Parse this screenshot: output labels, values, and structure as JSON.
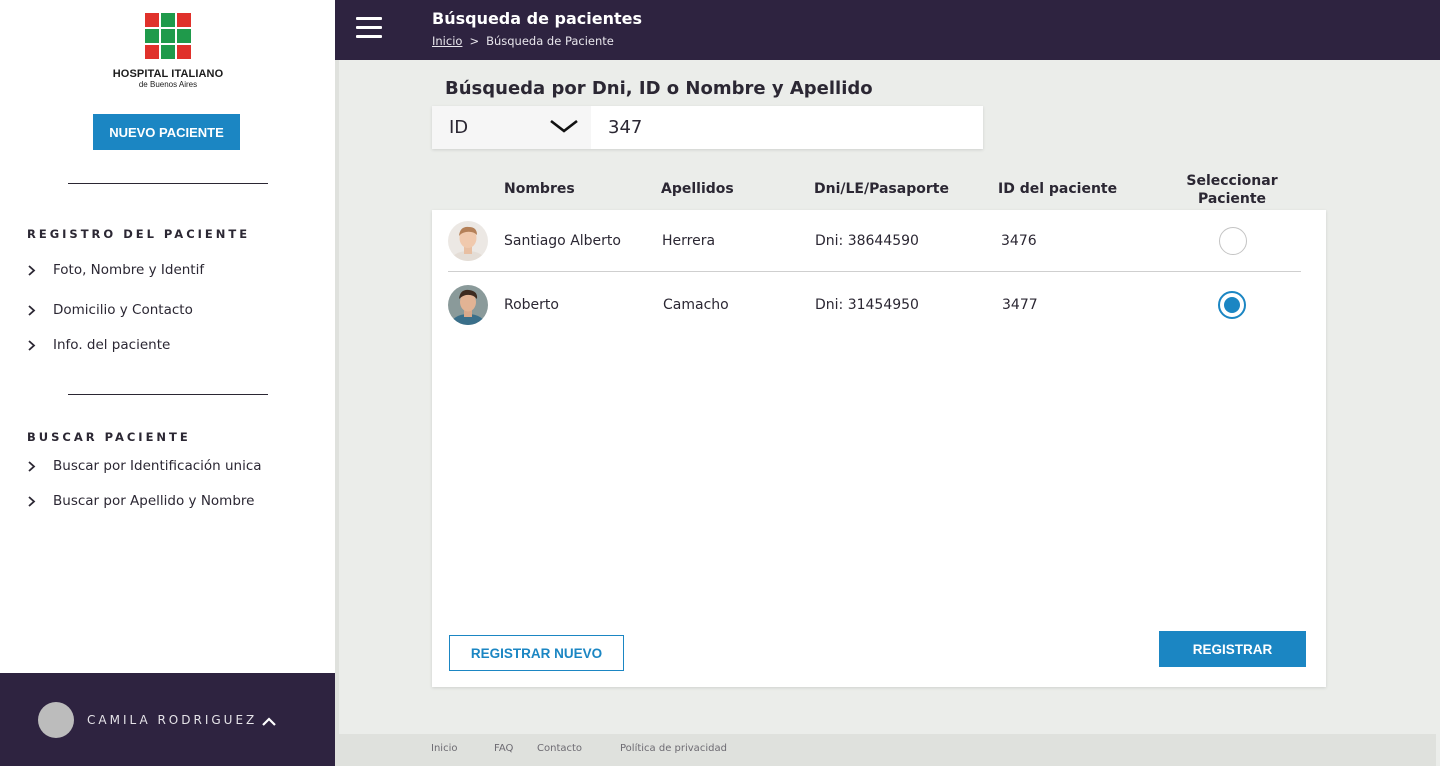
{
  "brand": {
    "name": "HOSPITAL ITALIANO",
    "sub": "de Buenos Aires",
    "colors": {
      "green": "#1f9a4b",
      "red": "#e0312b"
    }
  },
  "sidebar": {
    "new_patient_label": "NUEVO PACIENTE",
    "sections": [
      {
        "title": "REGISTRO DEL PACIENTE",
        "items": [
          "Foto, Nombre y Identif",
          "Domicilio y Contacto",
          "Info. del paciente"
        ]
      },
      {
        "title": "BUSCAR PACIENTE",
        "items": [
          "Buscar por Identificación unica",
          "Buscar por Apellido y Nombre"
        ]
      }
    ],
    "user": {
      "name": "CAMILA RODRIGUEZ",
      "menu_icon": "chevron-up-icon"
    }
  },
  "header": {
    "title": "Búsqueda de pacientes",
    "breadcrumb": {
      "home": "Inicio",
      "separator": ">",
      "current": "Búsqueda de Paciente"
    }
  },
  "search": {
    "heading": "Búsqueda por Dni, ID o Nombre y Apellido",
    "type_selected": "ID",
    "query": "347"
  },
  "table": {
    "columns": [
      "Nombres",
      "Apellidos",
      "Dni/LE/Pasaporte",
      "ID del paciente",
      "Seleccionar Paciente"
    ],
    "rows": [
      {
        "nombres": "Santiago Alberto",
        "apellidos": "Herrera",
        "dni": "Dni: 38644590",
        "id": "3476",
        "selected": false
      },
      {
        "nombres": "Roberto",
        "apellidos": "Camacho",
        "dni": "Dni: 31454950",
        "id": "3477",
        "selected": true
      }
    ]
  },
  "actions": {
    "register_new": "REGISTRAR NUEVO",
    "register": "REGISTRAR"
  },
  "footer": {
    "links": [
      "Inicio",
      "FAQ",
      "Contacto",
      "Política de privacidad"
    ]
  },
  "theme": {
    "primary": "#1b86c3",
    "dark": "#2e2340",
    "background": "#ebedea"
  }
}
